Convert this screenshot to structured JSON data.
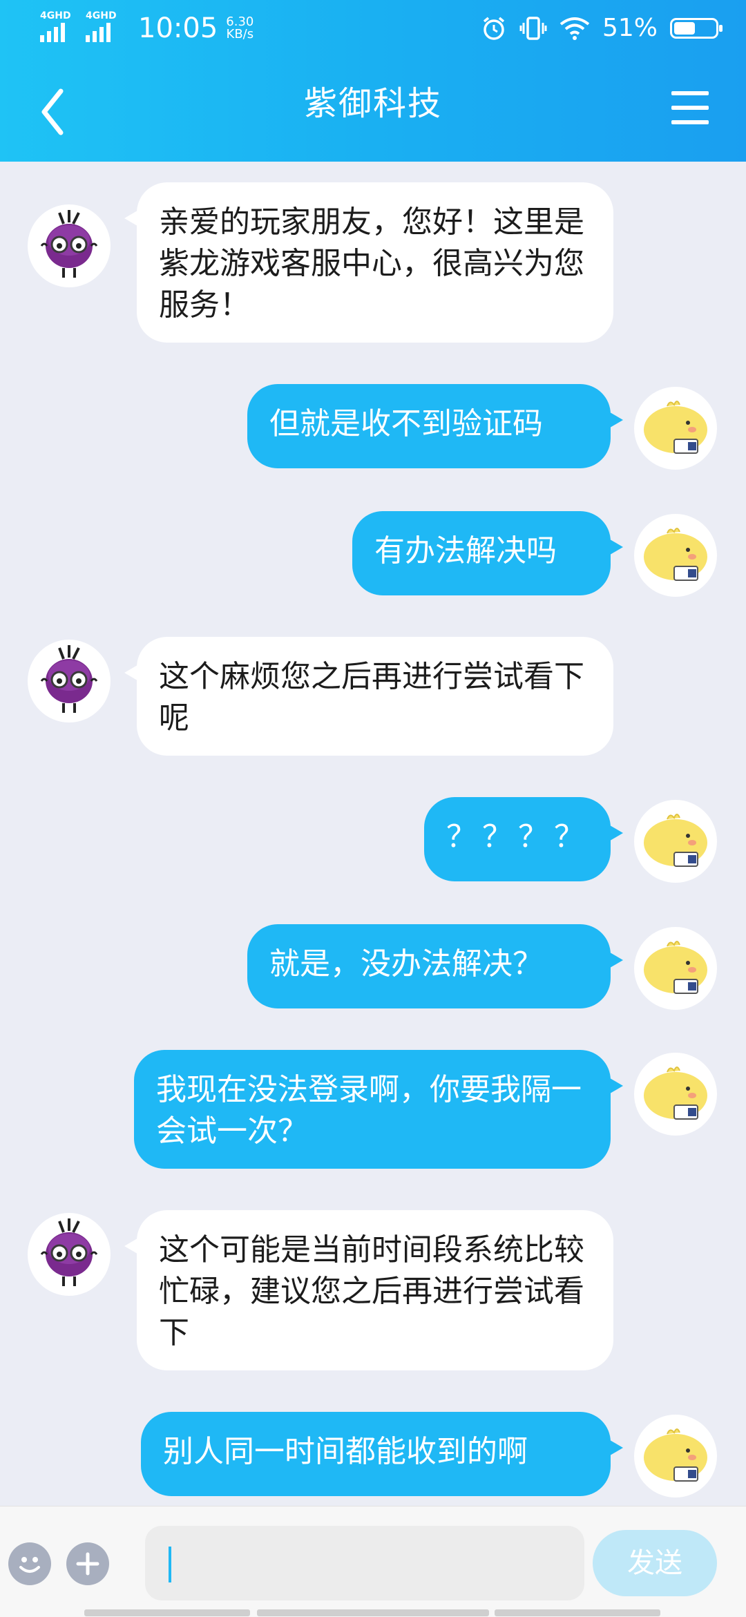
{
  "status_bar": {
    "network_1": "4GHD",
    "network_2": "4GHD",
    "time": "10:05",
    "speed_value": "6.30",
    "speed_unit": "KB/s",
    "battery": "51%",
    "battery_level": 0.51
  },
  "header": {
    "title": "紫御科技",
    "back_icon": "chevron-left-icon",
    "menu_icon": "hamburger-menu-icon",
    "accent_color": "#1fb0f2"
  },
  "messages": [
    {
      "from": "agent",
      "text": "亲爱的玩家朋友，您好！这里是紫龙游戏客服中心，很高兴为您服务！"
    },
    {
      "from": "user",
      "text": "但就是收不到验证码"
    },
    {
      "from": "user",
      "text": "有办法解决吗"
    },
    {
      "from": "agent",
      "text": "这个麻烦您之后再进行尝试看下呢"
    },
    {
      "from": "user",
      "text": "？？？？"
    },
    {
      "from": "user",
      "text": "就是，没办法解决？"
    },
    {
      "from": "user",
      "text": "我现在没法登录啊，你要我隔一会试一次？"
    },
    {
      "from": "agent",
      "text": "这个可能是当前时间段系统比较忙碌，建议您之后再进行尝试看下"
    },
    {
      "from": "user",
      "text": "别人同一时间都能收到的啊"
    }
  ],
  "input_bar": {
    "emoji_icon": "smiley-icon",
    "plus_icon": "plus-icon",
    "input_value": "",
    "send_label": "发送"
  },
  "colors": {
    "chat_bg": "#ebedf5",
    "user_bubble": "#1fb8f5",
    "agent_bubble": "#ffffff"
  }
}
